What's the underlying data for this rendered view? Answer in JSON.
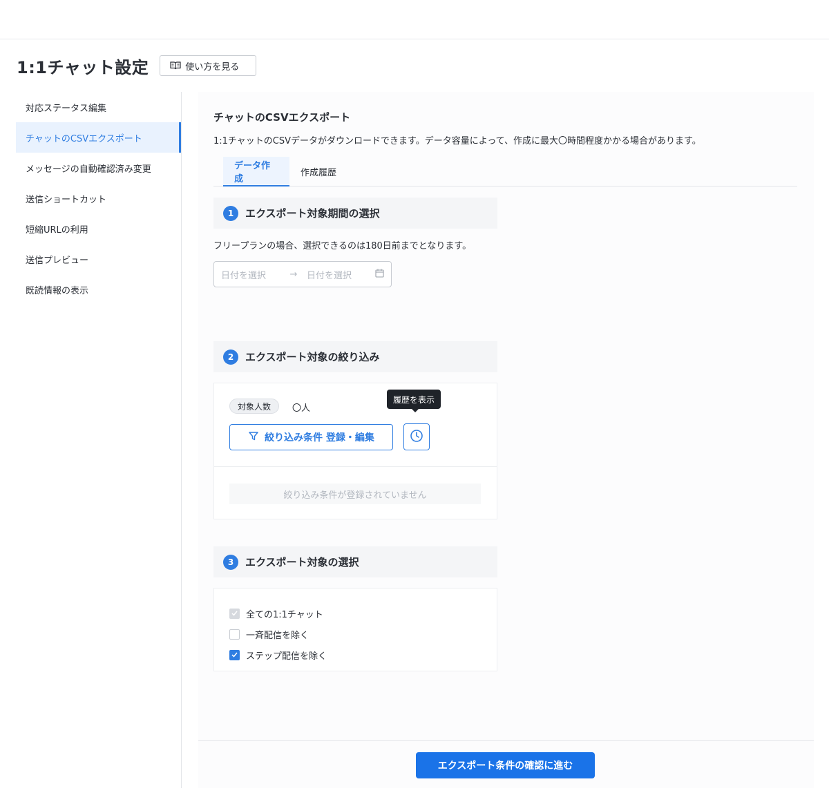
{
  "header": {
    "title": "1:1チャット設定",
    "howto_label": "使い方を見る"
  },
  "sidebar": {
    "items": [
      {
        "label": "対応ステータス編集"
      },
      {
        "label": "チャットのCSVエクスポート"
      },
      {
        "label": "メッセージの自動確認済み変更"
      },
      {
        "label": "送信ショートカット"
      },
      {
        "label": "短縮URLの利用"
      },
      {
        "label": "送信プレビュー"
      },
      {
        "label": "既読情報の表示"
      }
    ],
    "active_index": 1
  },
  "main": {
    "title": "チャットのCSVエクスポート",
    "description": "1:1チャットのCSVデータがダウンロードできます。データ容量によって、作成に最大〇時間程度かかる場合があります。",
    "tabs": [
      {
        "label": "データ作成"
      },
      {
        "label": "作成履歴"
      }
    ],
    "active_tab": 0,
    "step1": {
      "number": "1",
      "title": "エクスポート対象期間の選択",
      "note": "フリープランの場合、選択できるのは180日前までとなります。",
      "start_placeholder": "日付を選択",
      "arrow": "→",
      "end_placeholder": "日付を選択"
    },
    "step2": {
      "number": "2",
      "title": "エクスポート対象の絞り込み",
      "count_label": "対象人数",
      "count_value": "〇人",
      "tooltip": "履歴を表示",
      "filter_button": "絞り込み条件 登録・編集",
      "empty_message": "絞り込み条件が登録されていません"
    },
    "step3": {
      "number": "3",
      "title": "エクスポート対象の選択",
      "options": [
        {
          "label": "全ての1:1チャット",
          "checked": true,
          "disabled": true
        },
        {
          "label": "一斉配信を除く",
          "checked": false,
          "disabled": false
        },
        {
          "label": "ステップ配信を除く",
          "checked": true,
          "disabled": false
        }
      ]
    },
    "primary_button": "エクスポート条件の確認に進む"
  },
  "colors": {
    "accent": "#2f7de1",
    "primary_button": "#1a73e8",
    "tooltip_bg": "#1f2329"
  }
}
